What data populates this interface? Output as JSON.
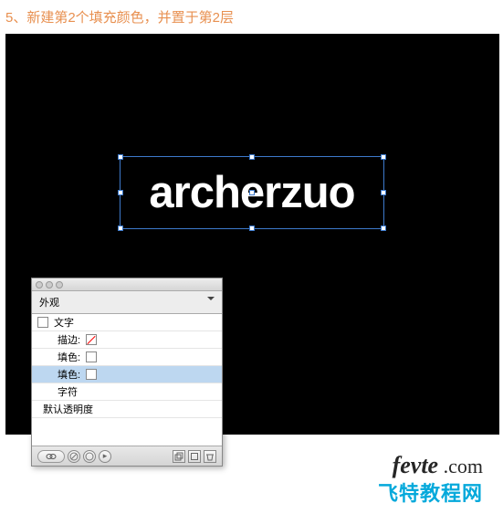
{
  "instruction": "5、新建第2个填充颜色，并置于第2层",
  "canvas": {
    "text": "archerzuo"
  },
  "panel": {
    "tab": "外观",
    "rows": {
      "type": "文字",
      "stroke": "描边:",
      "fill1": "填色:",
      "fill2": "填色:",
      "chars": "字符",
      "defaultOpacity": "默认透明度"
    }
  },
  "watermark": {
    "brand": "fevte",
    "suffix": " .com",
    "subtitle": "飞特教程网"
  }
}
